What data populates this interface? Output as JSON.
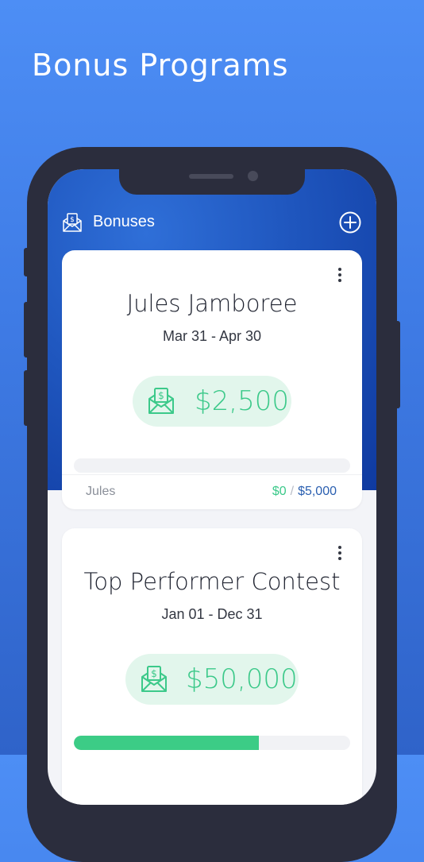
{
  "headline": "Bonus Programs",
  "appbar": {
    "title": "Bonuses",
    "icon": "bonus-envelope-icon",
    "add_icon": "plus-circle-icon"
  },
  "colors": {
    "background": "#4d8ef5",
    "accent_green": "#3cc98a",
    "pill_bg": "#e2f6ec",
    "goal_blue": "#2a5fb0"
  },
  "bonuses": [
    {
      "title": "Jules Jamboree",
      "dates": "Mar 31 - Apr 30",
      "amount": "$2,500",
      "owner": "Jules",
      "earned": "$0",
      "separator": "/",
      "goal": "$5,000",
      "progress": 0
    },
    {
      "title": "Top Performer Contest",
      "dates": "Jan 01 - Dec 31",
      "amount": "$50,000",
      "progress": 0.67
    }
  ]
}
